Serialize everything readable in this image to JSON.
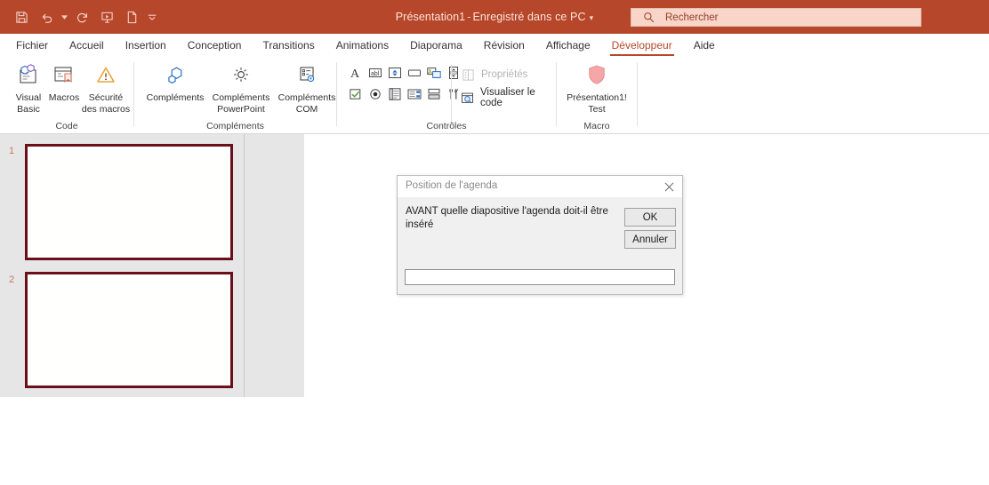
{
  "titlebar": {
    "quick_access": [
      {
        "name": "save-icon",
        "label": "Enregistrer"
      },
      {
        "name": "undo-icon",
        "label": "Annuler"
      },
      {
        "name": "undo-dropdown-caret-icon",
        "label": "Annuler (options)"
      },
      {
        "name": "redo-icon",
        "label": "Rétablir"
      },
      {
        "name": "start-slideshow-icon",
        "label": "Démarrer le diaporama"
      },
      {
        "name": "new-file-icon",
        "label": "Nouveau"
      },
      {
        "name": "customize-qat-caret-icon",
        "label": "Personnaliser la barre d'outils Accès rapide"
      }
    ],
    "document_name": "Présentation1",
    "separator": "-",
    "save_state": "Enregistré dans ce PC",
    "title_caret": "▾"
  },
  "search": {
    "placeholder": "Rechercher",
    "icon": "search-icon"
  },
  "tabs": [
    {
      "label": "Fichier",
      "active": false
    },
    {
      "label": "Accueil",
      "active": false
    },
    {
      "label": "Insertion",
      "active": false
    },
    {
      "label": "Conception",
      "active": false
    },
    {
      "label": "Transitions",
      "active": false
    },
    {
      "label": "Animations",
      "active": false
    },
    {
      "label": "Diaporama",
      "active": false
    },
    {
      "label": "Révision",
      "active": false
    },
    {
      "label": "Affichage",
      "active": false
    },
    {
      "label": "Développeur",
      "active": true
    },
    {
      "label": "Aide",
      "active": false
    }
  ],
  "ribbon": {
    "groups": [
      {
        "name": "code",
        "label": "Code",
        "buttons": [
          {
            "label_line1": "Visual",
            "label_line2": "Basic",
            "icon": "visual-basic-icon"
          },
          {
            "label_line1": "Macros",
            "label_line2": "",
            "icon": "macros-icon"
          },
          {
            "label_line1": "Sécurité",
            "label_line2": "des macros",
            "icon": "macro-security-warning-icon"
          }
        ]
      },
      {
        "name": "complements",
        "label": "Compléments",
        "buttons": [
          {
            "label_line1": "Compléments",
            "label_line2": "",
            "icon": "addins-hexagon-icon"
          },
          {
            "label_line1": "Compléments",
            "label_line2": "PowerPoint",
            "icon": "powerpoint-addins-gear-icon"
          },
          {
            "label_line1": "Compléments",
            "label_line2": "COM",
            "icon": "com-addins-icon"
          }
        ]
      },
      {
        "name": "controles",
        "label": "Contrôles",
        "row1_icons": [
          "label-control-icon",
          "textbox-control-icon",
          "spin-button-control-icon",
          "command-button-control-icon",
          "image-control-icon",
          "scrollbar-control-icon"
        ],
        "row2_icons": [
          "checkbox-control-icon",
          "option-button-control-icon",
          "listbox-control-icon",
          "combobox-control-icon",
          "toggle-button-control-icon",
          "more-controls-icon"
        ],
        "properties_label": "Propriétés",
        "properties_icon": "properties-grid-icon",
        "properties_disabled": true,
        "view_code_label": "Visualiser le code",
        "view_code_icon": "view-code-icon"
      },
      {
        "name": "macro",
        "label": "Macro",
        "buttons": [
          {
            "label_line1": "Présentation1!",
            "label_line2": "Test",
            "icon": "macro-shield-icon"
          }
        ]
      }
    ]
  },
  "slide_pane": {
    "slides": [
      {
        "number": "1",
        "selected": true
      },
      {
        "number": "2",
        "selected": false
      }
    ]
  },
  "dialog": {
    "title": "Position de l'agenda",
    "close_icon": "close-icon",
    "prompt": "AVANT quelle diapositive l'agenda doit-il être inséré",
    "ok_label": "OK",
    "cancel_label": "Annuler",
    "input_value": "",
    "input_placeholder": ""
  },
  "colors": {
    "brand_red": "#b7472a",
    "accent_tab_underline": "#b7472a",
    "search_field": "#f8d5c8",
    "thumb_border": "#6b0f1a",
    "pane_background": "#e6e6e6",
    "dialog_background": "#f0f0f0"
  }
}
